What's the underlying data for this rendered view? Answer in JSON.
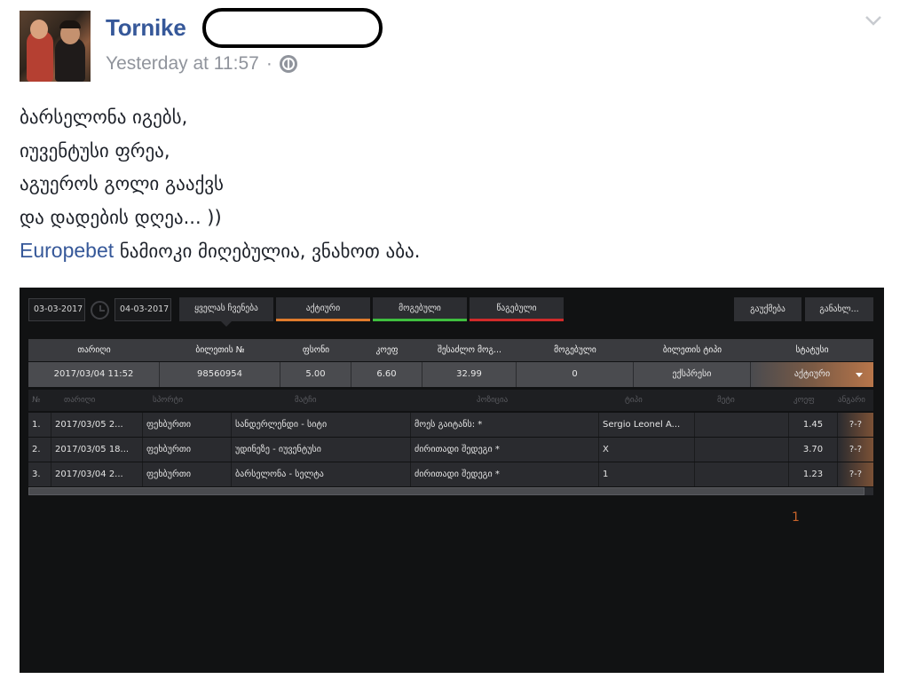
{
  "post": {
    "author": "Tornike",
    "timestamp": "Yesterday at 11:57",
    "separator": "·",
    "privacy_icon": "globe-icon",
    "menu_icon": "chevron-down-icon",
    "lines": [
      "ბარსელონა იგებს,",
      "იუვენტუსი ფრეა,",
      "აგუეროს გოლი გააქვს",
      "და დადების დღეა... ))"
    ],
    "link_text": "Europebet",
    "last_line_rest": " ნამიოკი მიღებულია, ვნახოთ აბა."
  },
  "shot": {
    "date_from": "03-03-2017",
    "date_to": "04-03-2017",
    "filters": [
      {
        "label": "ყველას ჩვენება",
        "color": "#2c2d31"
      },
      {
        "label": "აქტიური",
        "color": "#e07b2c"
      },
      {
        "label": "მოგებული",
        "color": "#3fbf3f"
      },
      {
        "label": "წაგებული",
        "color": "#d02a2a"
      }
    ],
    "cancel_label": "გაუქმება",
    "refresh_label": "განახლ...",
    "ticket_headers": [
      "თარიღი",
      "ბილეთის №",
      "ფსონი",
      "კოეფ",
      "შესაძლო მოგ...",
      "მოგებული",
      "ბილეთის ტიპი",
      "სტატუსი"
    ],
    "ticket": {
      "date": "2017/03/04 11:52",
      "number": "98560954",
      "stake": "5.00",
      "coef": "6.60",
      "possible": "32.99",
      "won": "0",
      "type": "ექსპრესი",
      "status": "აქტიური"
    },
    "bet_headers": [
      "№",
      "თარიღი",
      "სპორტი",
      "მატჩი",
      "პოზიცია",
      "ტიპი",
      "მეტი",
      "კოეფ",
      "ანგარი"
    ],
    "bets": [
      {
        "num": "1.",
        "date": "2017/03/05 2...",
        "sport": "ფეხბურთი",
        "match": "სანდერლენდი - სიტი",
        "position": "მოეს გაიტანს: *",
        "type": "Sergio Leonel A...",
        "extra": "",
        "coef": "1.45",
        "result": "?-?"
      },
      {
        "num": "2.",
        "date": "2017/03/05 18...",
        "sport": "ფეხბურთი",
        "match": "უდინეზე - იუვენტუსი",
        "position": "ძირითადი შედეგი *",
        "type": "X",
        "extra": "",
        "coef": "3.70",
        "result": "?-?"
      },
      {
        "num": "3.",
        "date": "2017/03/04 2...",
        "sport": "ფეხბურთი",
        "match": "ბარსელონა - სელტა",
        "position": "ძირითადი შედეგი *",
        "type": "1",
        "extra": "",
        "coef": "1.23",
        "result": "?-?"
      }
    ],
    "page": "1"
  }
}
